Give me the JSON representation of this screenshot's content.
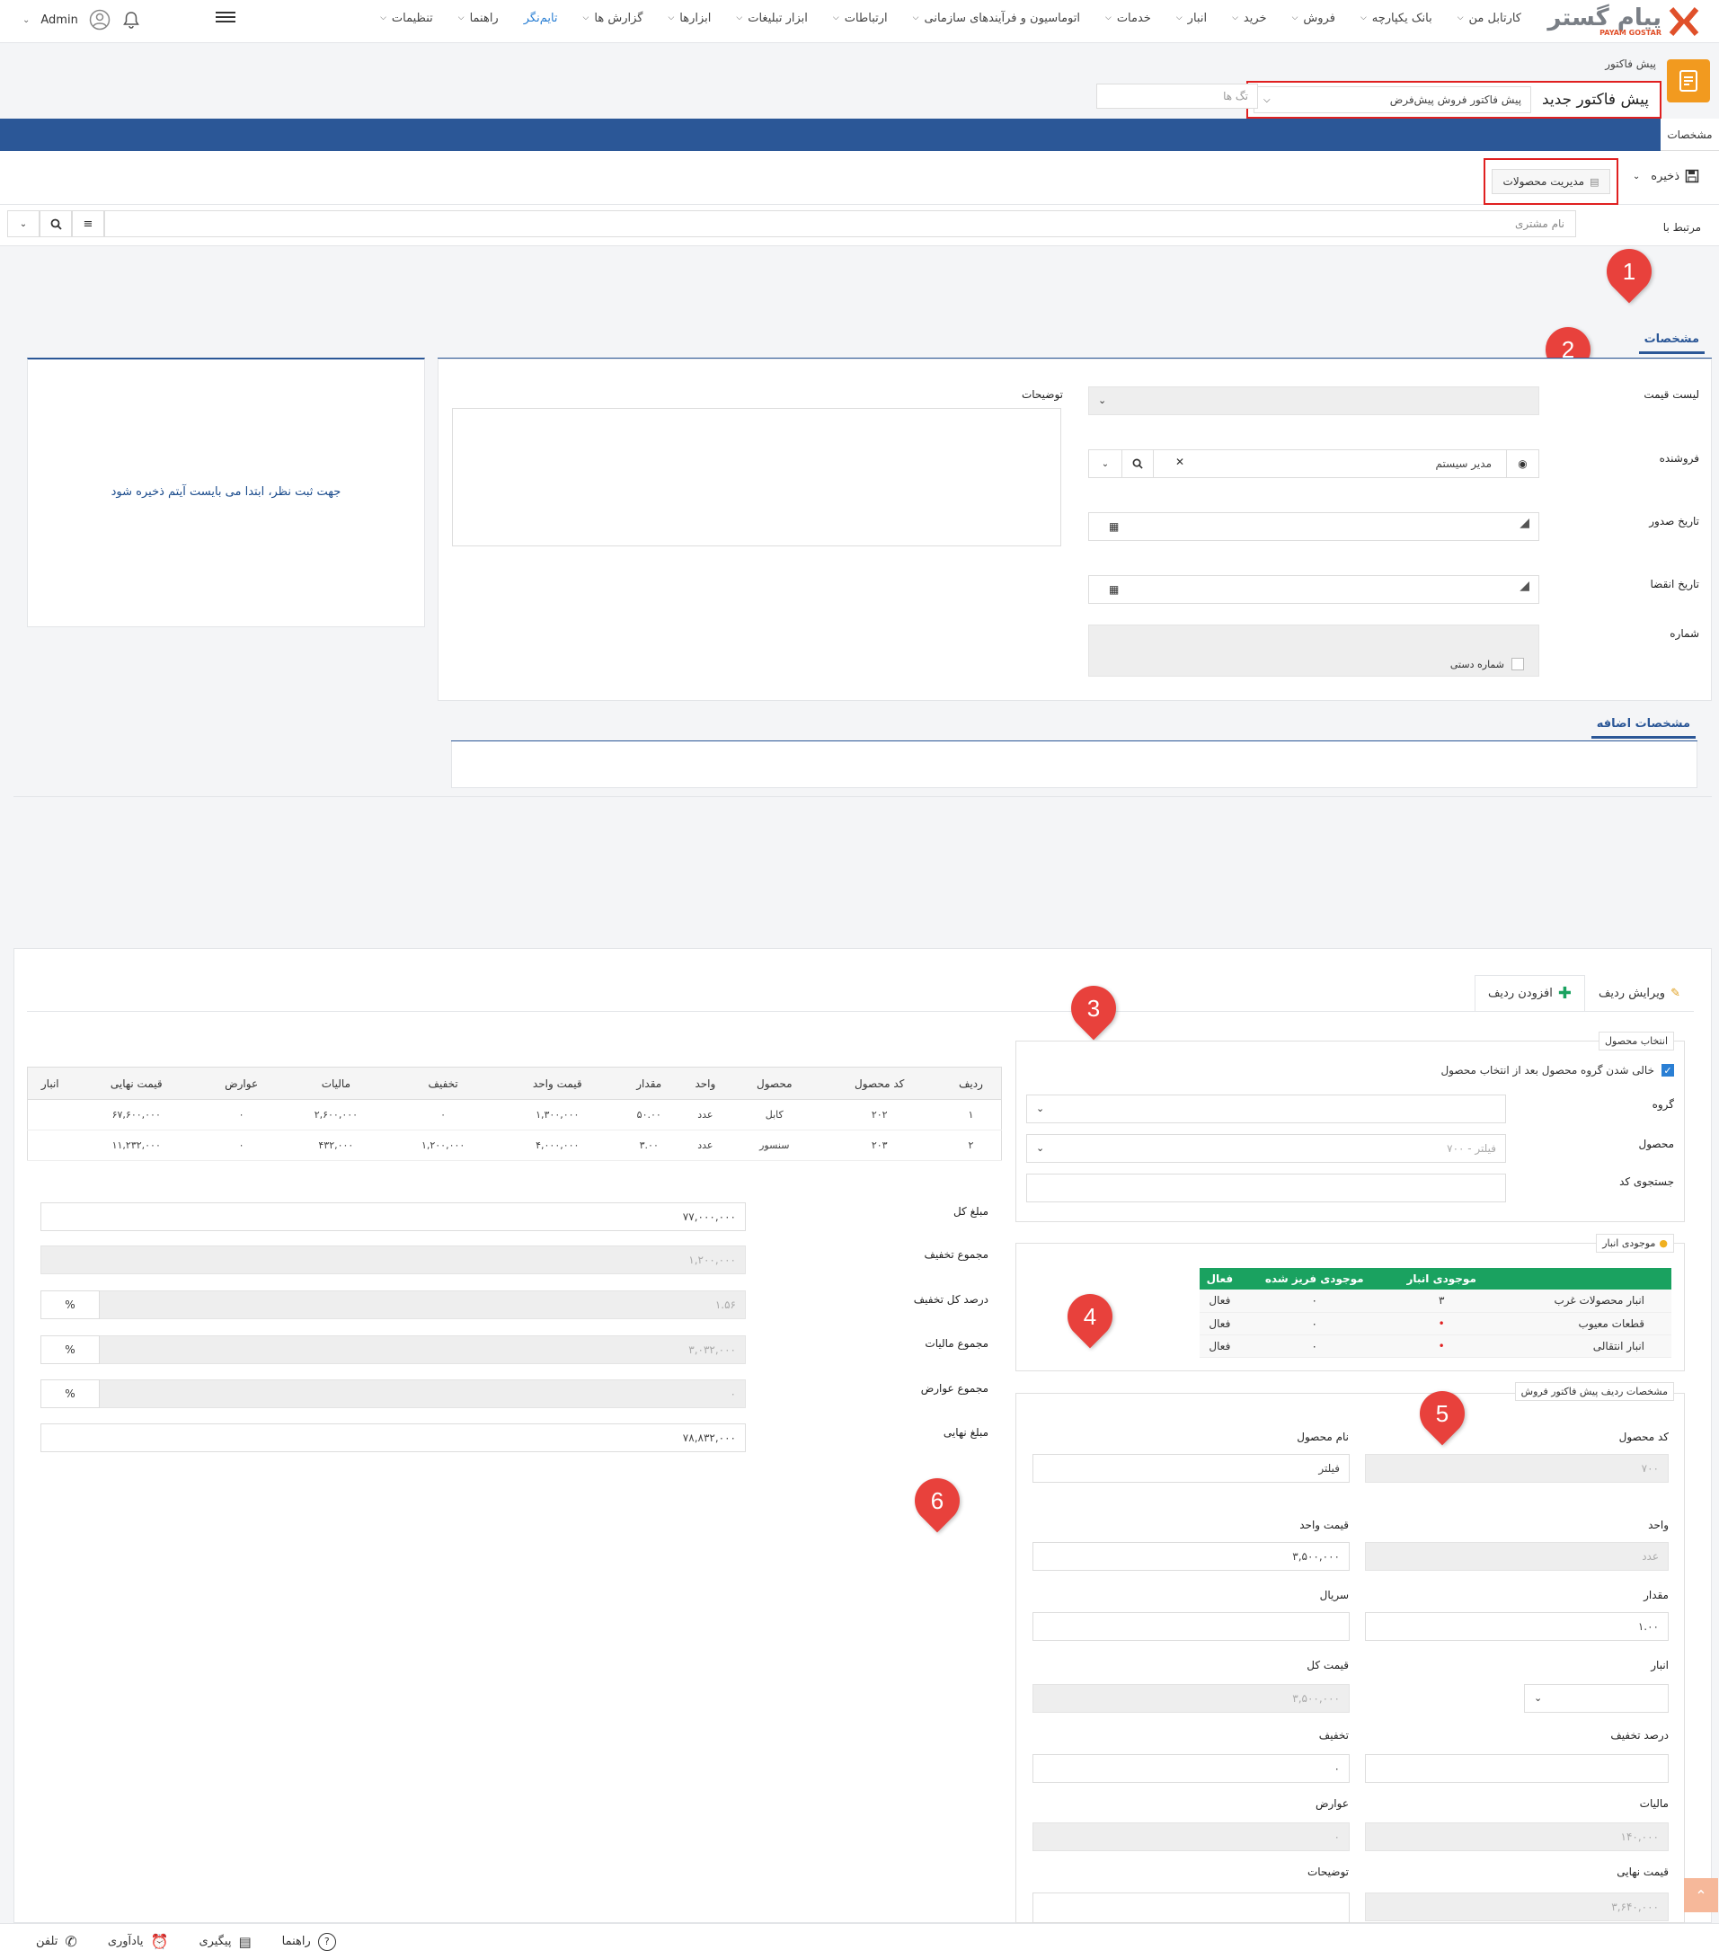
{
  "nav": {
    "logo_fa": "پیام گستر",
    "logo_en": "PAYAM GOSTAR",
    "menu": [
      {
        "label": "کارتابل من",
        "active": false
      },
      {
        "label": "بانک یکپارچه",
        "active": false
      },
      {
        "label": "فروش",
        "active": false
      },
      {
        "label": "خرید",
        "active": false
      },
      {
        "label": "انبار",
        "active": false
      },
      {
        "label": "خدمات",
        "active": false
      },
      {
        "label": "اتوماسیون و فرآیندهای سازمانی",
        "active": false
      },
      {
        "label": "ارتباطات",
        "active": false
      },
      {
        "label": "ابزار تبلیغات",
        "active": false
      },
      {
        "label": "ابزارها",
        "active": false
      },
      {
        "label": "گزارش ها",
        "active": false
      },
      {
        "label": "تایم‌نگر",
        "active": true
      },
      {
        "label": "راهنما",
        "active": false
      },
      {
        "label": "تنظیمات",
        "active": false
      }
    ],
    "user": "Admin"
  },
  "header": {
    "breadcrumb": "پیش فاکتور",
    "title": "پیش فاکتور جدید",
    "type_select": "پیش فاکتور فروش پیش‌فرض",
    "tags_placeholder": "تگ ها",
    "blue_tab": "مشخصات"
  },
  "toolbar": {
    "save": "ذخیره",
    "product_manager": "مدیریت محصولات"
  },
  "related": {
    "label": "مرتبط با",
    "placeholder": "نام مشتری"
  },
  "markers": [
    "1",
    "2",
    "3",
    "4",
    "5",
    "6"
  ],
  "spec": {
    "tab": "مشخصات",
    "price_list_label": "لیست قیمت",
    "seller_label": "فروشنده",
    "seller_value": "مدیر سیستم",
    "issue_date_label": "تاریخ صدور",
    "expire_date_label": "تاریخ انقضا",
    "number_label": "شماره",
    "manual_number": "شماره دستی",
    "description_label": "توضیحات",
    "note_msg": "جهت ثبت نظر، ابتدا می بایست آیتم ذخیره شود"
  },
  "extra": {
    "tab": "مشخصات اضافه"
  },
  "products": {
    "tab_edit": "ویرایش ردیف",
    "tab_add": "افزودن ردیف",
    "table_headers": [
      "ردیف",
      "کد محصول",
      "محصول",
      "واحد",
      "مقدار",
      "قیمت واحد",
      "تخفیف",
      "مالیات",
      "عوارض",
      "قیمت نهایی",
      "انبار"
    ],
    "rows": [
      [
        "۱",
        "۲۰۲",
        "کابل",
        "عدد",
        "۵۰.۰۰",
        "۱,۳۰۰,۰۰۰",
        "۰",
        "۲,۶۰۰,۰۰۰",
        "۰",
        "۶۷,۶۰۰,۰۰۰",
        ""
      ],
      [
        "۲",
        "۲۰۳",
        "سنسور",
        "عدد",
        "۳.۰۰",
        "۴,۰۰۰,۰۰۰",
        "۱,۲۰۰,۰۰۰",
        "۴۳۲,۰۰۰",
        "۰",
        "۱۱,۲۳۲,۰۰۰",
        ""
      ]
    ],
    "select_legend": "انتخاب محصول",
    "clear_group": "خالی شدن گروه محصول بعد از انتخاب محصول",
    "group_label": "گروه",
    "product_label": "محصول",
    "product_value": "فیلتر - ۷۰۰",
    "code_search_label": "جستجوی کد",
    "stock_legend": "موجودی انبار",
    "stock_headers": [
      "",
      "موجودی انبار",
      "موجودی فریز شده",
      "فعال"
    ],
    "stock_rows": [
      {
        "name": "انبار محصولات غرب",
        "qty": "۳",
        "frozen": "۰",
        "status": "فعال",
        "qty_red": false
      },
      {
        "name": "قطعات معیوب",
        "qty": "•",
        "frozen": "۰",
        "status": "فعال",
        "qty_red": true
      },
      {
        "name": "انبار انتقالی",
        "qty": "•",
        "frozen": "۰",
        "status": "فعال",
        "qty_red": true
      }
    ],
    "row_legend": "مشخصات ردیف پیش فاکتور فروش",
    "code_label": "کد محصول",
    "code_value": "۷۰۰",
    "name_label": "نام محصول",
    "name_value": "فیلتر",
    "unit_label": "واحد",
    "unit_value": "عدد",
    "unit_price_label": "قیمت واحد",
    "unit_price_value": "۳,۵۰۰,۰۰۰",
    "qty_label": "مقدار",
    "qty_value": "۱.۰۰",
    "serial_label": "سریال",
    "warehouse_label": "انبار",
    "total_price_label": "قیمت کل",
    "total_price_value": "۳,۵۰۰,۰۰۰",
    "discount_pct_label": "درصد تخفیف",
    "discount_label": "تخفیف",
    "discount_value": "۰",
    "tax_label": "مالیات",
    "tax_value": "۱۴۰,۰۰۰",
    "duties_label": "عوارض",
    "duties_value": "۰",
    "final_price_label": "قیمت نهایی",
    "final_price_value": "۳,۶۴۰,۰۰۰",
    "row_desc_label": "توضیحات"
  },
  "totals": {
    "total_label": "مبلغ کل",
    "total_value": "۷۷,۰۰۰,۰۰۰",
    "discount_sum_label": "مجموع تخفیف",
    "discount_sum_value": "۱,۲۰۰,۰۰۰",
    "discount_pct_label": "درصد کل تخفیف",
    "discount_pct_value": "۱.۵۶",
    "tax_sum_label": "مجموع مالیات",
    "tax_sum_value": "۳,۰۳۲,۰۰۰",
    "duties_sum_label": "مجموع عوارض",
    "duties_sum_value": "۰",
    "final_label": "مبلغ نهایی",
    "final_value": "۷۸,۸۳۲,۰۰۰",
    "pct_symbol": "%"
  },
  "footer": {
    "phone": "تلفن",
    "reminder": "یادآوری",
    "followup": "پیگیری",
    "help": "راهنما"
  },
  "colors": {
    "brand_blue": "#2b5797",
    "highlight_red": "#e02020",
    "marker_red": "#e8413c",
    "stock_green": "#1aa260",
    "app_orange": "#f29a1f"
  }
}
